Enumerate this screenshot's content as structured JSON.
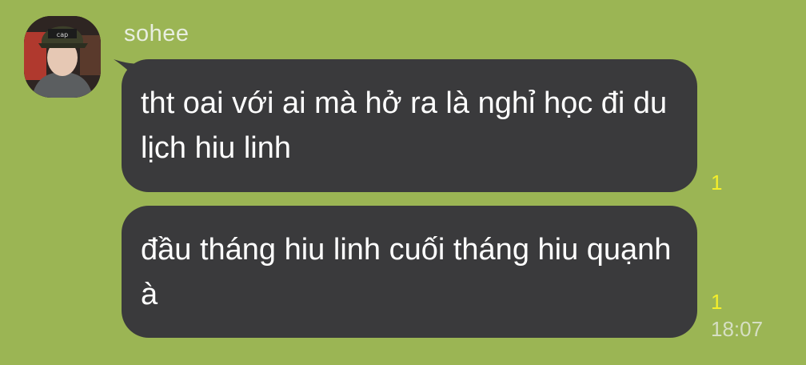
{
  "sender": {
    "name": "sohee",
    "avatar_icon": "profile-photo"
  },
  "messages": [
    {
      "text": "tht oai với ai mà hở ra là nghỉ học đi du lịch hiu linh",
      "read_count": "1"
    },
    {
      "text": "đầu tháng hiu linh cuối tháng hiu quạnh à",
      "read_count": "1",
      "time": "18:07"
    }
  ],
  "colors": {
    "background": "#9bb554",
    "bubble": "#3a3a3c",
    "read_count": "#f4ee2a",
    "message_text": "#ffffff"
  }
}
